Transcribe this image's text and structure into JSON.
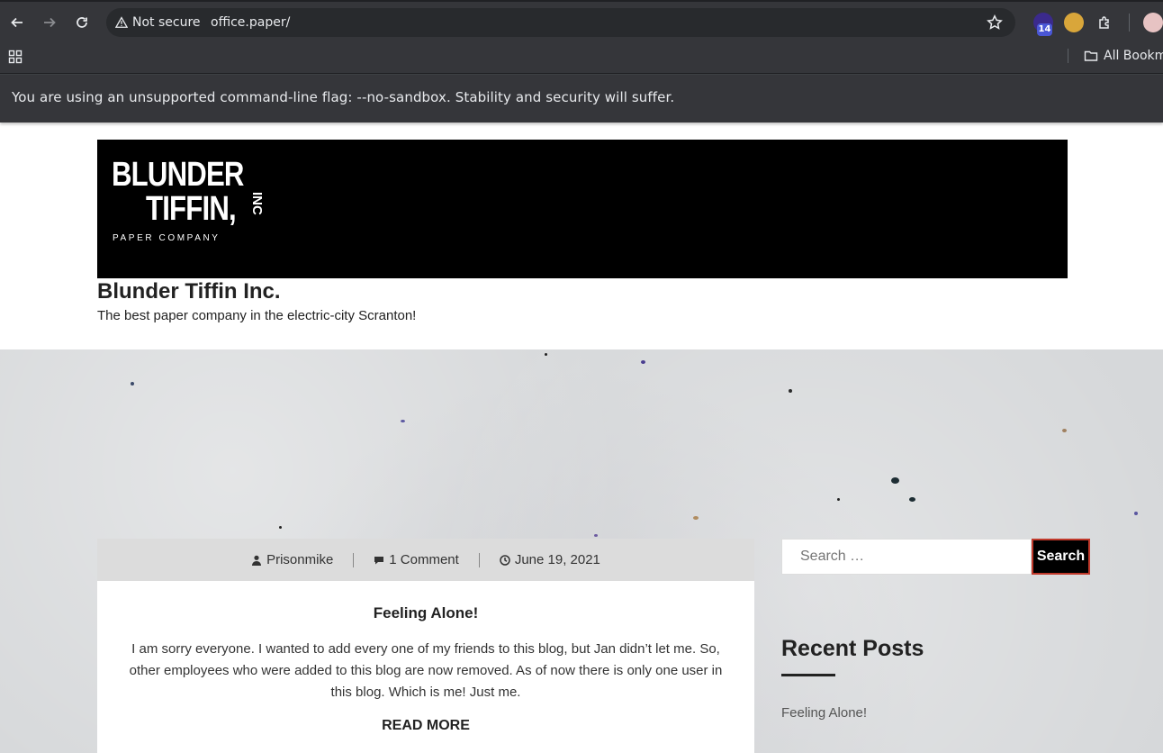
{
  "browser": {
    "security_label": "Not secure",
    "url": "office.paper/",
    "extension_badge": "14",
    "bookmarks_label": "All Bookm",
    "infobar_message": "You are using an unsupported command-line flag: --no-sandbox. Stability and security will suffer."
  },
  "site": {
    "logo": {
      "line1": "BLUNDER",
      "line2": "TIFFIN,",
      "line3": "INC",
      "line4": "PAPER COMPANY"
    },
    "title": "Blunder Tiffin Inc.",
    "description": "The best paper company in the electric-city Scranton!"
  },
  "post": {
    "author": "Prisonmike",
    "comments": "1 Comment",
    "date": "June 19, 2021",
    "title": "Feeling Alone!",
    "excerpt": "I am sorry everyone. I wanted to add every one of my friends to this blog, but Jan didn’t let me. So, other employees who were added to this blog are now removed. As of now there is only one user in this blog. Which is me! Just me.",
    "read_more": "READ MORE"
  },
  "sidebar": {
    "search_placeholder": "Search …",
    "search_button": "Search",
    "recent_posts_title": "Recent Posts",
    "recent_posts": [
      "Feeling Alone!"
    ]
  }
}
